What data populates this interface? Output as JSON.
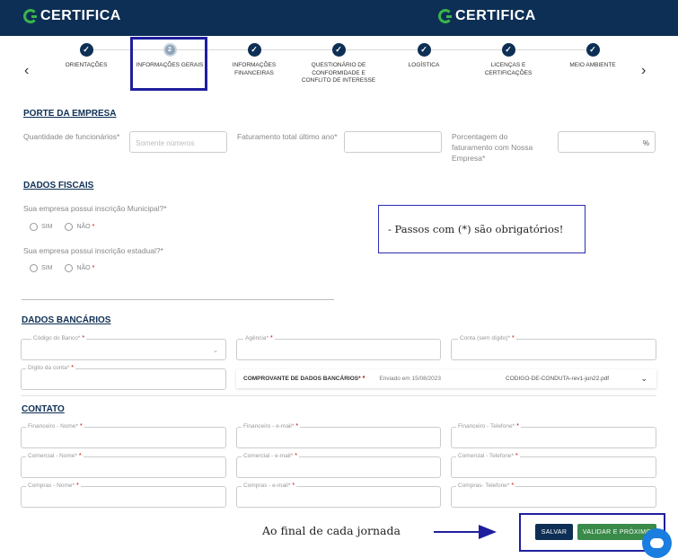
{
  "header": {
    "logo_left": "CERTIFICA",
    "logo_center": "CERTIFICA"
  },
  "stepper": {
    "prev": "‹",
    "next": "›",
    "steps": [
      {
        "label": "ORIENTAÇÕES",
        "state": "done",
        "mark": "✓"
      },
      {
        "label": "INFORMAÇÕES GERAIS",
        "state": "active",
        "mark": "2"
      },
      {
        "label": "INFORMAÇÕES FINANCEIRAS",
        "state": "done",
        "mark": "✓"
      },
      {
        "label": "QUESTIONÁRIO DE CONFORMIDADE E CONFLITO DE INTERESSE",
        "state": "done",
        "mark": "✓"
      },
      {
        "label": "LOGÍSTICA",
        "state": "done",
        "mark": "✓"
      },
      {
        "label": "LICENÇAS E CERTIFICAÇÕES",
        "state": "done",
        "mark": "✓"
      },
      {
        "label": "MEIO AMBIENTE",
        "state": "done",
        "mark": "✓"
      }
    ]
  },
  "porte": {
    "title": "PORTE DA EMPRESA",
    "funcionarios_label": "Quantidade de funcionários*",
    "funcionarios_placeholder": "Somente números",
    "faturamento_label": "Faturamento total último ano*",
    "porcentagem_label": "Porcentagem do faturamento com Nossa Empresa*",
    "porcentagem_suffix": "%"
  },
  "fiscais": {
    "title": "DADOS FISCAIS",
    "q1": "Sua empresa possui inscrição Municipal?*",
    "q2": "Sua empresa possui inscrição estadual?*",
    "sim": "SIM",
    "nao": "NÃO",
    "req": "*"
  },
  "note": "- Passos com (*) são obrigatórios!",
  "bancarios": {
    "title": "DADOS BANCÁRIOS",
    "codigo_banco": "Código do Banco*",
    "agencia": "Agência*",
    "conta": "Conta (sem dígito)*",
    "digito": "Dígito da conta*",
    "comprovante_label": "COMPROVANTE DE DADOS BANCÁRIOS*",
    "comprovante_date": "Enviado em 15/08/2023",
    "comprovante_file": "CODIGO-DE-CONDUTA-rev1-jun22.pdf",
    "req": "*"
  },
  "contato": {
    "title": "CONTATO",
    "fields": [
      "Financeiro - Nome*",
      "Financeiro - e-mail*",
      "Financeiro - Telefone*",
      "Comercial - Nome*",
      "Comercial - e-mail*",
      "Comercial - Telefone*",
      "Compras - Nome*",
      "Compras - e-mail*",
      "Compras- Telefone*"
    ]
  },
  "footer": {
    "annotation": "Ao final de cada jornada",
    "salvar": "SALVAR",
    "validar": "VALIDAR E PRÓXIMO"
  },
  "colors": {
    "primary": "#0e2f55",
    "accent": "#3ab54a",
    "highlight": "#1f1f9e",
    "required": "#cc0000"
  },
  "icons": {
    "logo": "certifica-logo-icon",
    "check": "check-icon",
    "chevron": "chevron-down-icon",
    "chat": "chat-icon"
  }
}
